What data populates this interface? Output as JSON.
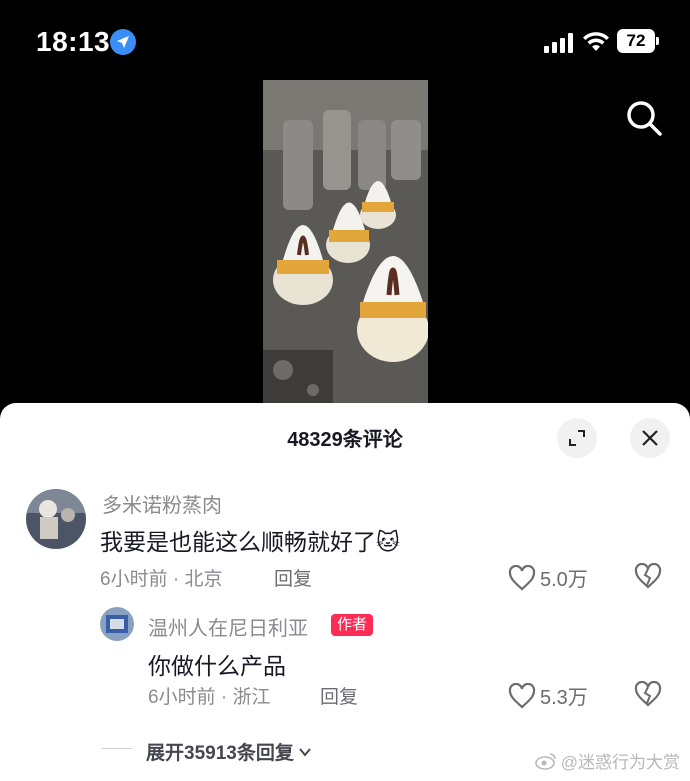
{
  "status_bar": {
    "time": "18:13",
    "battery": "72"
  },
  "comments": {
    "count_title": "48329条评论",
    "items": [
      {
        "username": "多米诺粉蒸肉",
        "text": "我要是也能这么顺畅就好了",
        "emoji": "🐱",
        "meta": "6小时前 · 北京",
        "reply_label": "回复",
        "likes": "5.0万"
      },
      {
        "username": "温州人在尼日利亚",
        "badge": "作者",
        "text": "你做什么产品",
        "meta": "6小时前 · 浙江",
        "reply_label": "回复",
        "likes": "5.3万"
      }
    ],
    "expand_label": "展开35913条回复"
  },
  "watermark": "@迷惑行为大赏",
  "colors": {
    "accent": "#fe2c55",
    "location": "#3a8ef6"
  }
}
